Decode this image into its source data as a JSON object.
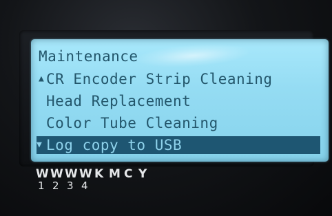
{
  "screen": {
    "title": "Maintenance",
    "items": [
      {
        "arrow": "▲",
        "label": "CR Encoder Strip Cleaning"
      },
      {
        "arrow": "",
        "label": "Head Replacement"
      },
      {
        "arrow": "",
        "label": "Color Tube Cleaning"
      },
      {
        "arrow": "▼",
        "label": "Log copy to USB"
      }
    ],
    "selected_index": 3
  },
  "ink_slots": {
    "letters": [
      "W",
      "W",
      "W",
      "W",
      "K",
      "M",
      "C",
      "Y"
    ],
    "numbers": [
      "1",
      "2",
      "3",
      "4"
    ]
  },
  "colors": {
    "lcd_background": "#9ddff5",
    "lcd_text": "#23566b",
    "highlight": "#1e5672"
  }
}
